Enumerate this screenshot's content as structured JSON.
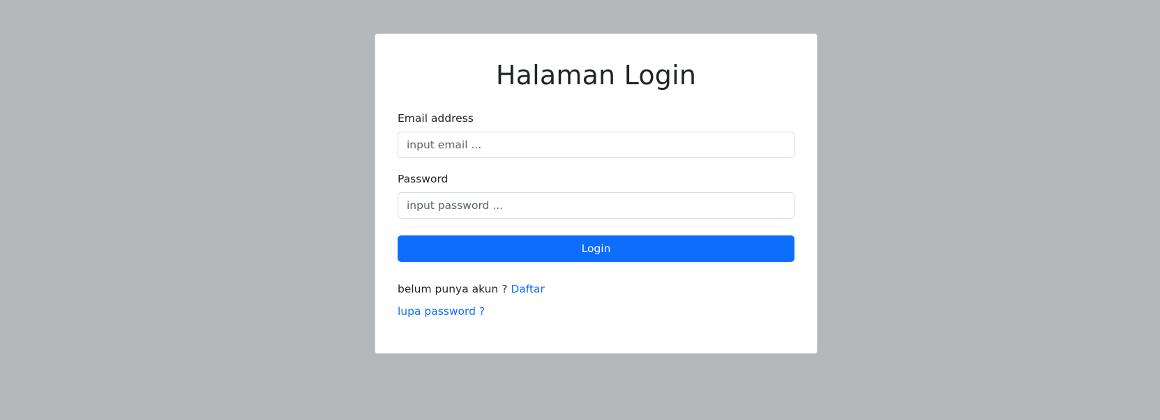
{
  "page": {
    "title": "Halaman Login"
  },
  "form": {
    "email_label": "Email address",
    "email_placeholder": "input email ...",
    "email_value": "",
    "password_label": "Password",
    "password_placeholder": "input password ...",
    "password_value": "",
    "login_label": "Login"
  },
  "footer": {
    "register_prompt": "belum punya akun ? ",
    "register_link": "Daftar",
    "forgot_link": "lupa password ?"
  },
  "colors": {
    "background": "#b4b8bb",
    "card": "#ffffff",
    "primary": "#0d6efd",
    "text": "#212529"
  }
}
